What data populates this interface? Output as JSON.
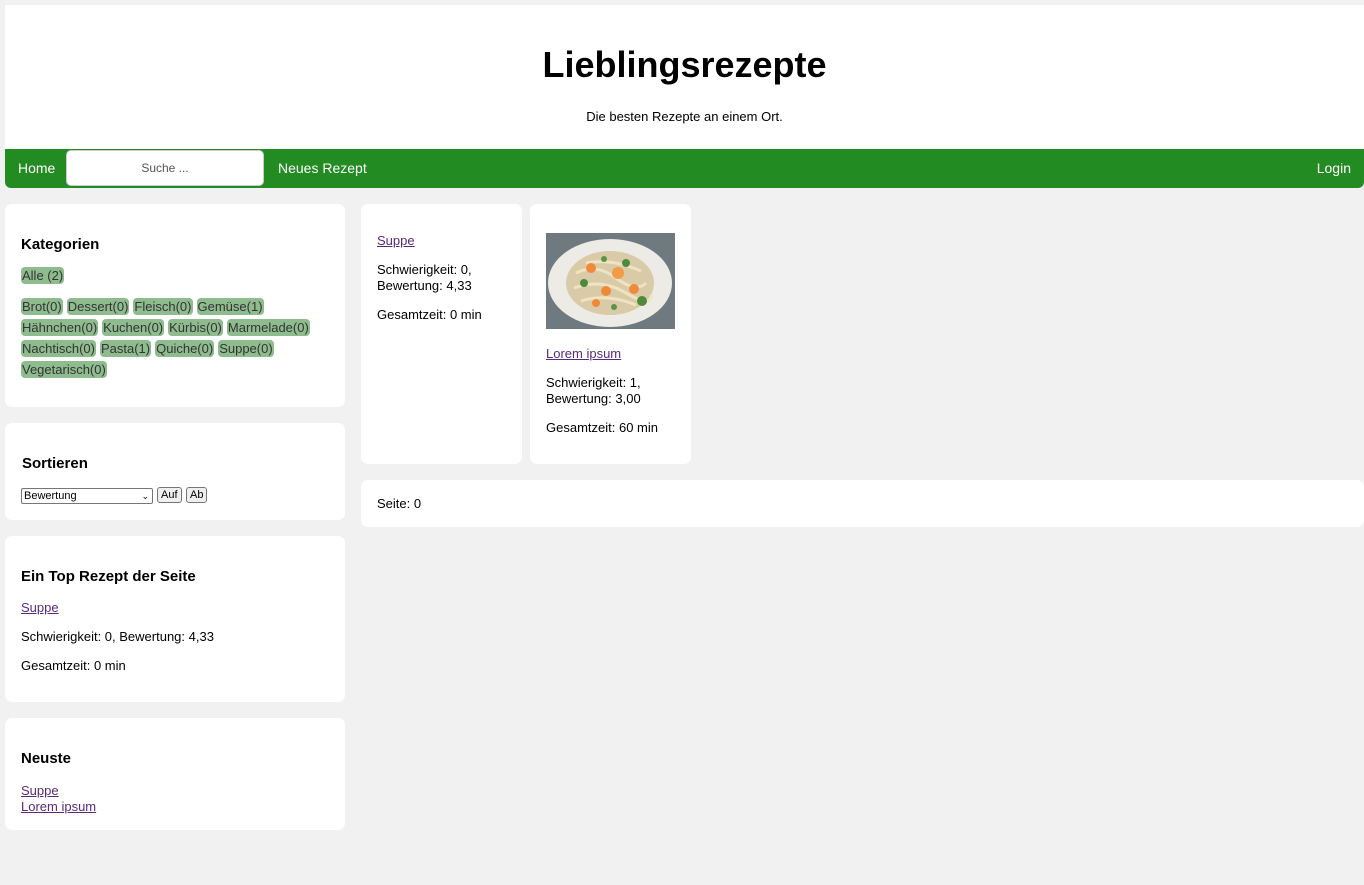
{
  "header": {
    "title": "Lieblingsrezepte",
    "subtitle": "Die besten Rezepte an einem Ort."
  },
  "nav": {
    "home": "Home",
    "search_placeholder": "Suche ...",
    "new_recipe": "Neues Rezept",
    "login": "Login",
    "bg_color": "#228b22"
  },
  "categories": {
    "title": "Kategorien",
    "all": "Alle (2)",
    "items": [
      "Brot(0)",
      "Dessert(0)",
      "Fleisch(0)",
      "Gemüse(1)",
      "Hähnchen(0)",
      "Kuchen(0)",
      "Kürbis(0)",
      "Marmelade(0)",
      "Nachtisch(0)",
      "Pasta(1)",
      "Quiche(0)",
      "Suppe(0)",
      "Vegetarisch(0)"
    ],
    "tag_color": "#8fbc8f"
  },
  "sort": {
    "title": "Sortieren",
    "selected": "Bewertung",
    "asc": "Auf",
    "desc": "Ab"
  },
  "top_recipe": {
    "title": "Ein Top Rezept der Seite",
    "name": "Suppe",
    "details": "Schwierigkeit: 0, Bewertung: 4,33",
    "time": "Gesamtzeit: 0 min"
  },
  "newest": {
    "title": "Neuste",
    "items": [
      "Suppe",
      "Lorem ipsum"
    ]
  },
  "recipes": [
    {
      "name": "Suppe",
      "difficulty": "Schwierigkeit: 0,",
      "rating": "Bewertung: 4,33",
      "time": "Gesamtzeit: 0 min"
    },
    {
      "name": "Lorem ipsum",
      "difficulty": "Schwierigkeit: 1,",
      "rating": "Bewertung: 3,00",
      "time": "Gesamtzeit: 60 min",
      "image": "pasta-dish-photo"
    }
  ],
  "pagination": {
    "label": "Seite: 0"
  }
}
